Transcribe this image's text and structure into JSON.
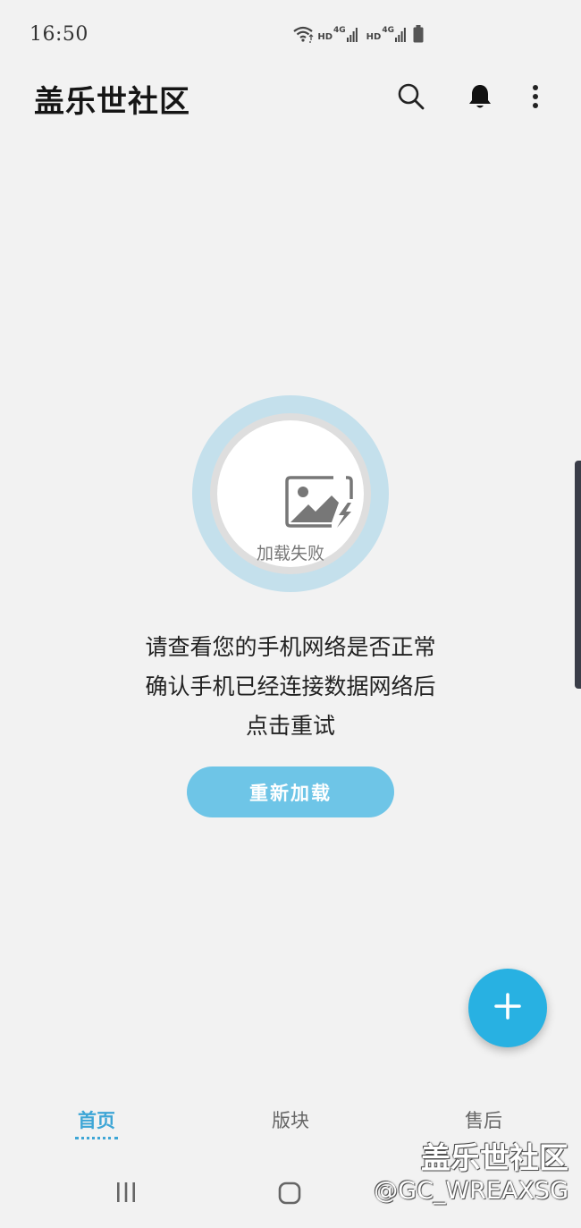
{
  "status_bar": {
    "time": "16:50",
    "icons": [
      "wifi-icon",
      "signal-hd-4g-icon",
      "signal-hd-4g-icon",
      "battery-icon"
    ],
    "sim1_label": "HD",
    "sim1_net": "4G",
    "sim2_label": "HD",
    "sim2_net": "4G"
  },
  "app_bar": {
    "title": "盖乐世社区",
    "actions": [
      "search-icon",
      "bell-icon",
      "more-vert-icon"
    ]
  },
  "error": {
    "image_label": "加载失败",
    "message_lines": [
      "请查看您的手机网络是否正常",
      "确认手机已经连接数据网络后",
      "点击重试"
    ],
    "reload_label": "重新加载"
  },
  "fab": {
    "icon": "plus-icon"
  },
  "bottom_nav": {
    "tabs": [
      {
        "label": "首页",
        "active": true
      },
      {
        "label": "版块",
        "active": false
      },
      {
        "label": "售后",
        "active": false
      }
    ]
  },
  "watermark": {
    "title": "盖乐世社区",
    "handle": "@GC_WREAXSG"
  },
  "colors": {
    "background": "#f2f2f2",
    "accent": "#28b1e2",
    "reload_button": "#6ec5e7",
    "active_tab": "#3ea6d6"
  }
}
